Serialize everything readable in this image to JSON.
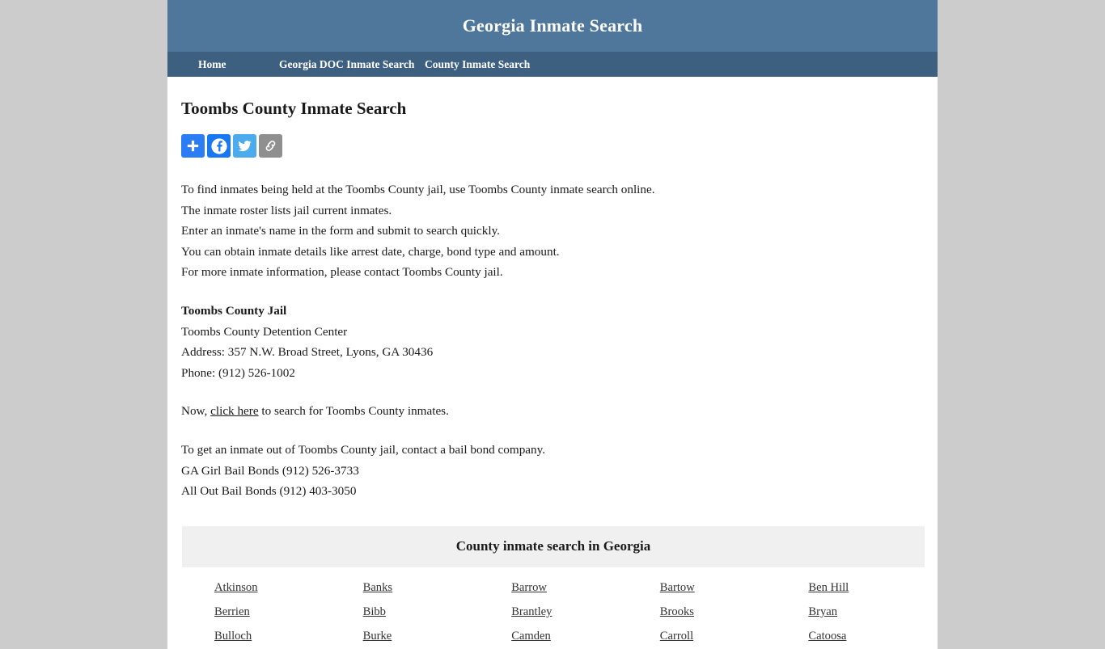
{
  "header": {
    "title": "Georgia Inmate Search"
  },
  "nav": {
    "items": [
      {
        "label": "Home",
        "name": "nav-home"
      },
      {
        "label": "Georgia DOC Inmate Search",
        "name": "nav-doc-search"
      },
      {
        "label": "County Inmate Search",
        "name": "nav-county-search"
      }
    ]
  },
  "main": {
    "page_title": "Toombs County Inmate Search",
    "share": {
      "buttons": [
        {
          "label": "Share",
          "icon": "plus-icon",
          "color": "#2a7df4"
        },
        {
          "label": "Facebook",
          "icon": "facebook-icon",
          "color": "#1877f2"
        },
        {
          "label": "Twitter",
          "icon": "twitter-icon",
          "color": "#4cabec"
        },
        {
          "label": "Copy Link",
          "icon": "link-icon",
          "color": "#8f8f8f"
        }
      ]
    },
    "intro_lines": [
      "To find inmates being held at the Toombs County jail, use Toombs County inmate search online.",
      "The inmate roster lists jail current inmates.",
      "Enter an inmate's name in the form and submit to search quickly.",
      "You can obtain inmate details like arrest date, charge, bond type and amount.",
      "For more inmate information, please contact Toombs County jail."
    ],
    "jail": {
      "name": "Toombs County Jail",
      "facility": "Toombs County Detention Center",
      "address": "Address: 357 N.W. Broad Street, Lyons, GA 30436",
      "phone": "Phone: (912) 526-1002"
    },
    "search_line": {
      "prefix": "Now, ",
      "link_text": "click here",
      "suffix": " to search for Toombs County inmates."
    },
    "bail": {
      "intro": "To get an inmate out of Toombs County jail, contact a bail bond company.",
      "bondsmen": [
        "GA Girl Bail Bonds (912) 526-3733",
        "All Out Bail Bonds (912) 403-3050"
      ]
    },
    "county_table": {
      "caption": "County inmate search in Georgia",
      "rows": [
        [
          "Atkinson",
          "Banks",
          "Barrow",
          "Bartow",
          "Ben Hill"
        ],
        [
          "Berrien",
          "Bibb",
          "Brantley",
          "Brooks",
          "Bryan"
        ],
        [
          "Bulloch",
          "Burke",
          "Camden",
          "Carroll",
          "Catoosa"
        ]
      ]
    }
  },
  "colors": {
    "header_blue": "#4e779b",
    "nav_blue": "#3d5f80",
    "page_background": "#cccccc",
    "table_header": "#f0f0f0"
  }
}
